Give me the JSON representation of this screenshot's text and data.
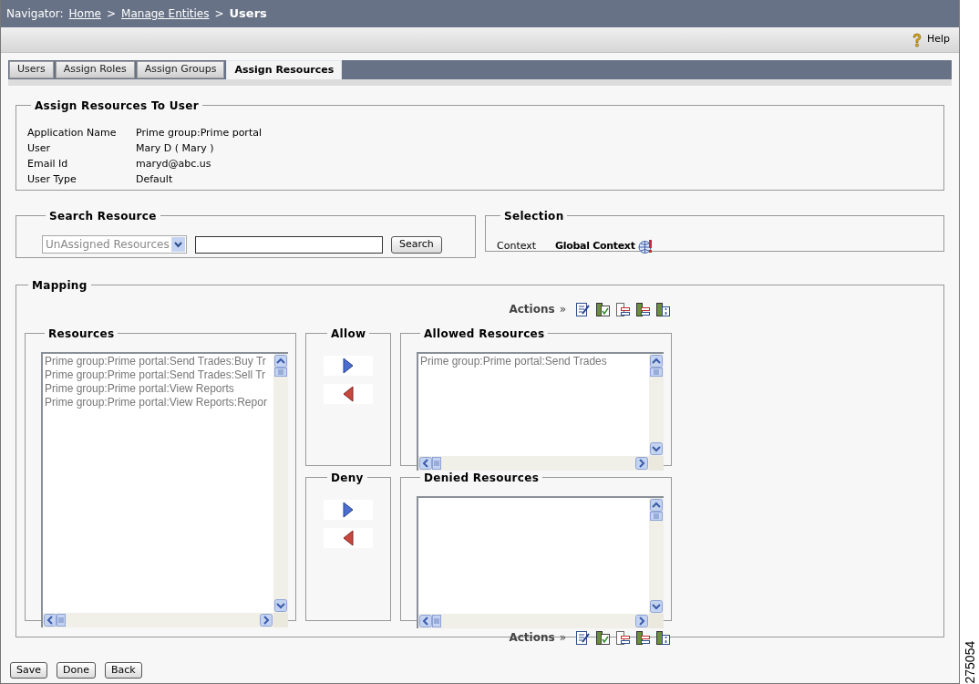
{
  "navigator": {
    "label": "Navigator:",
    "crumbs": [
      {
        "text": "Home",
        "kind": "link"
      },
      {
        "text": "Manage Entities",
        "kind": "link"
      },
      {
        "text": "Users",
        "kind": "current"
      }
    ],
    "separators": [
      ">",
      ">"
    ]
  },
  "toolbar": {
    "help": "Help"
  },
  "tabs": [
    {
      "label": "Users",
      "selected": false
    },
    {
      "label": "Assign Roles",
      "selected": false
    },
    {
      "label": "Assign Groups",
      "selected": false
    },
    {
      "label": "Assign Resources",
      "selected": true
    }
  ],
  "user_info": {
    "title": "Assign Resources To User",
    "fields": [
      {
        "label": "Application Name",
        "value": "Prime group:Prime portal"
      },
      {
        "label": "User",
        "value": "Mary D ( Mary )"
      },
      {
        "label": "Email Id",
        "value": "maryd@abc.us"
      },
      {
        "label": "User Type",
        "value": "Default"
      }
    ]
  },
  "search_resource": {
    "title": "Search Resource",
    "dropdown": "UnAssigned Resources",
    "button": "Search"
  },
  "selection": {
    "title": "Selection",
    "label": "Context",
    "value": "Global Context"
  },
  "mapping": {
    "title": "Mapping",
    "actions_top": {
      "label": "Actions",
      "arrow": "»"
    },
    "resources": {
      "title": "Resources",
      "items": [
        "Prime group:Prime portal:Send Trades:Buy Tr",
        "Prime group:Prime portal:Send Trades:Sell Tr",
        "Prime group:Prime portal:View Reports",
        "Prime group:Prime portal:View Reports:Repor"
      ]
    },
    "allow": {
      "title": "Allow"
    },
    "deny": {
      "title": "Deny"
    },
    "allowed": {
      "title": "Allowed Resources",
      "items": [
        "Prime group:Prime portal:Send Trades"
      ]
    },
    "denied": {
      "title": "Denied Resources"
    },
    "actions_bottom": {
      "label": "Actions",
      "arrow": "»"
    }
  },
  "buttons": [
    "Save",
    "Done",
    "Back"
  ],
  "figure_number": "275054"
}
